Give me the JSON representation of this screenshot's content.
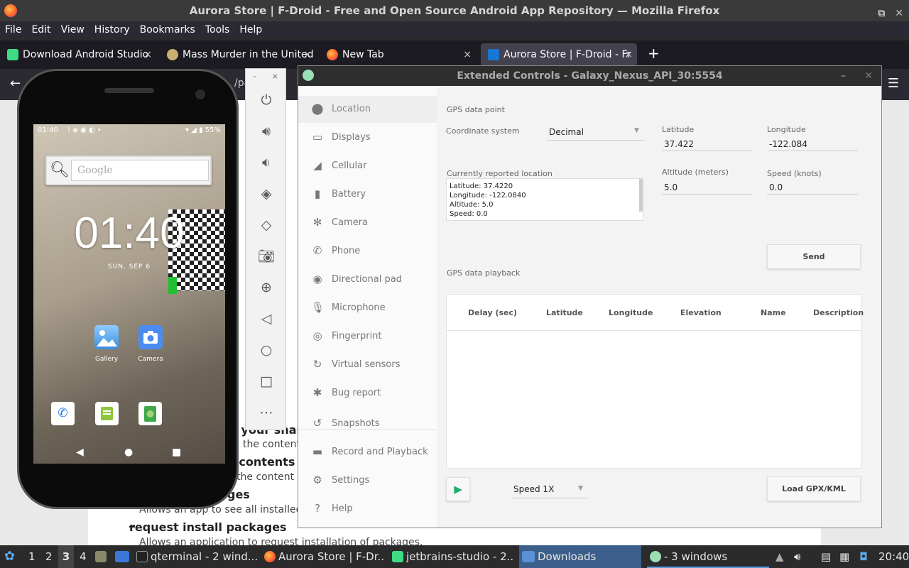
{
  "firefox": {
    "title": "Aurora Store | F-Droid - Free and Open Source Android App Repository — Mozilla Firefox",
    "menu": [
      "File",
      "Edit",
      "View",
      "History",
      "Bookmarks",
      "Tools",
      "Help"
    ],
    "tabs": [
      {
        "label": "Download Android Studio",
        "icon": "android-studio-icon"
      },
      {
        "label": "Mass Murder in the United",
        "icon": "site-icon"
      },
      {
        "label": "New Tab",
        "icon": "firefox-icon"
      },
      {
        "label": "Aurora Store | F-Droid - Fr",
        "icon": "fdroid-icon"
      }
    ],
    "new_tab": "+",
    "close": "×",
    "url_fragment": "/pa    co"
  },
  "page": {
    "permissions": [
      {
        "title": "of your shar",
        "desc": "the contents"
      },
      {
        "title": "e contents",
        "desc": "e the content"
      },
      {
        "title": "ges",
        "desc": "Allows an app to see all installed pa"
      },
      {
        "title": "request install packages",
        "desc": "Allows an application to request installation of packages."
      }
    ]
  },
  "phone": {
    "status_time": "01:40",
    "battery": "55%",
    "search_placeholder": "Google",
    "clock": "01:40",
    "date": "SUN, SEP 6",
    "apps": [
      {
        "label": "Gallery"
      },
      {
        "label": "Camera"
      }
    ]
  },
  "emulator_toolbar": {
    "minimize": "–",
    "close": "×",
    "buttons": [
      "power",
      "volume-up",
      "volume-down",
      "rotate-left",
      "rotate-right",
      "screenshot",
      "zoom",
      "back",
      "home",
      "overview",
      "more"
    ]
  },
  "extended_controls": {
    "title": "Extended Controls - Galaxy_Nexus_API_30:5554",
    "sidebar": [
      {
        "label": "Location",
        "icon": "location-pin-icon"
      },
      {
        "label": "Displays",
        "icon": "display-icon"
      },
      {
        "label": "Cellular",
        "icon": "cellular-icon"
      },
      {
        "label": "Battery",
        "icon": "battery-icon"
      },
      {
        "label": "Camera",
        "icon": "camera-icon"
      },
      {
        "label": "Phone",
        "icon": "phone-icon"
      },
      {
        "label": "Directional pad",
        "icon": "dpad-icon"
      },
      {
        "label": "Microphone",
        "icon": "microphone-icon"
      },
      {
        "label": "Fingerprint",
        "icon": "fingerprint-icon"
      },
      {
        "label": "Virtual sensors",
        "icon": "sensors-icon"
      },
      {
        "label": "Bug report",
        "icon": "bug-icon"
      },
      {
        "label": "Snapshots",
        "icon": "snapshots-icon"
      },
      {
        "label": "Record and Playback",
        "icon": "record-icon"
      },
      {
        "label": "Settings",
        "icon": "gear-icon"
      },
      {
        "label": "Help",
        "icon": "help-icon"
      }
    ],
    "gps_point": {
      "heading": "GPS data point",
      "coordinate_system_label": "Coordinate system",
      "coordinate_system_value": "Decimal",
      "latitude_label": "Latitude",
      "latitude_value": "37.422",
      "longitude_label": "Longitude",
      "longitude_value": "-122.084",
      "altitude_label": "Altitude (meters)",
      "altitude_value": "5.0",
      "speed_label": "Speed (knots)",
      "speed_value": "0.0",
      "reported_label": "Currently reported location",
      "reported_lines": [
        "Latitude: 37.4220",
        "Longitude: -122.0840",
        "Altitude: 5.0",
        "Speed: 0.0"
      ],
      "send_button": "Send"
    },
    "playback": {
      "heading": "GPS data playback",
      "columns": [
        "Delay (sec)",
        "Latitude",
        "Longitude",
        "Elevation",
        "Name",
        "Description"
      ],
      "speed_value": "Speed 1X",
      "load_button": "Load GPX/KML"
    }
  },
  "taskbar": {
    "workspaces": [
      "1",
      "2",
      "3",
      "4"
    ],
    "items": [
      {
        "label": "qterminal - 2 wind..."
      },
      {
        "label": "Aurora Store | F-Dr..."
      },
      {
        "label": "jetbrains-studio - 2..."
      },
      {
        "label": "Downloads"
      },
      {
        "label": "- 3 windows"
      }
    ],
    "clock": "20:40"
  }
}
